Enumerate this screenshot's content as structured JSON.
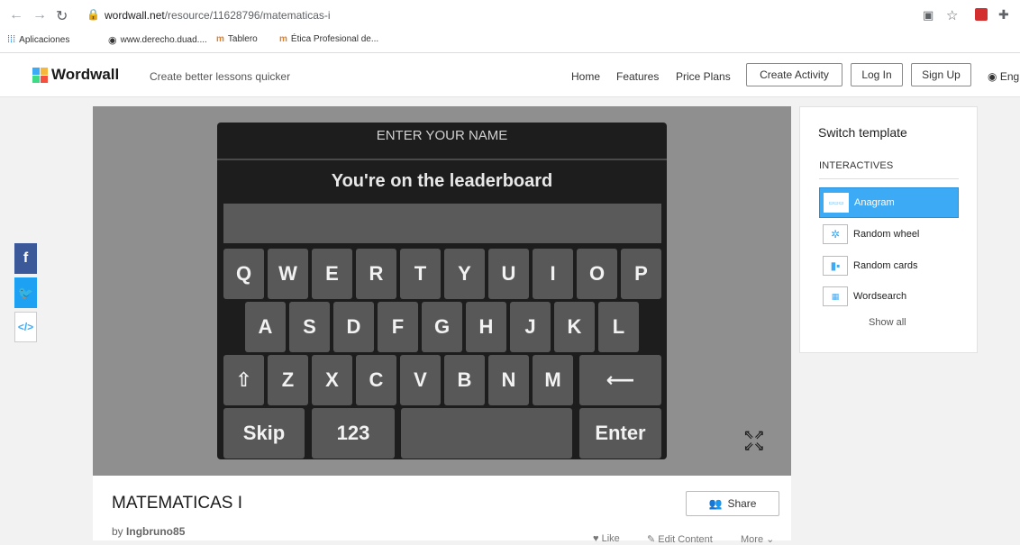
{
  "browser": {
    "url_host": "wordwall.net",
    "url_path": "/resource/11628796/matematicas-i",
    "bookmarks": [
      "Aplicaciones",
      "www.derecho.duad....",
      "Tablero",
      "Ética Profesional de..."
    ]
  },
  "header": {
    "logo": "Wordwall",
    "tagline": "Create better lessons quicker",
    "nav": [
      "Home",
      "Features",
      "Price Plans"
    ],
    "create_activity": "Create Activity",
    "log_in": "Log In",
    "sign_up": "Sign Up",
    "language": "Eng"
  },
  "game": {
    "title": "ENTER YOUR NAME",
    "subtitle": "You're on the leaderboard",
    "row1": [
      "Q",
      "W",
      "E",
      "R",
      "T",
      "Y",
      "U",
      "I",
      "O",
      "P"
    ],
    "row2": [
      "A",
      "S",
      "D",
      "F",
      "G",
      "H",
      "J",
      "K",
      "L"
    ],
    "row3": [
      "Z",
      "X",
      "C",
      "V",
      "B",
      "N",
      "M"
    ],
    "shift": "⇧",
    "backspace": "⟵",
    "skip": "Skip",
    "numbers": "123",
    "enter": "Enter"
  },
  "activity": {
    "title": "MATEMATICAS I",
    "by": "by",
    "author": "Ingbruno85",
    "share": "Share",
    "like": "Like",
    "edit": "Edit Content",
    "more": "More"
  },
  "sidebar": {
    "title": "Switch template",
    "section": "INTERACTIVES",
    "items": [
      "Anagram",
      "Random wheel",
      "Random cards",
      "Wordsearch"
    ],
    "show_all": "Show all"
  },
  "colors": {
    "accent": "#3daaf5",
    "facebook": "#3b5998",
    "twitter": "#1da1f2",
    "board": "#1d1d1d",
    "key": "#585858"
  }
}
